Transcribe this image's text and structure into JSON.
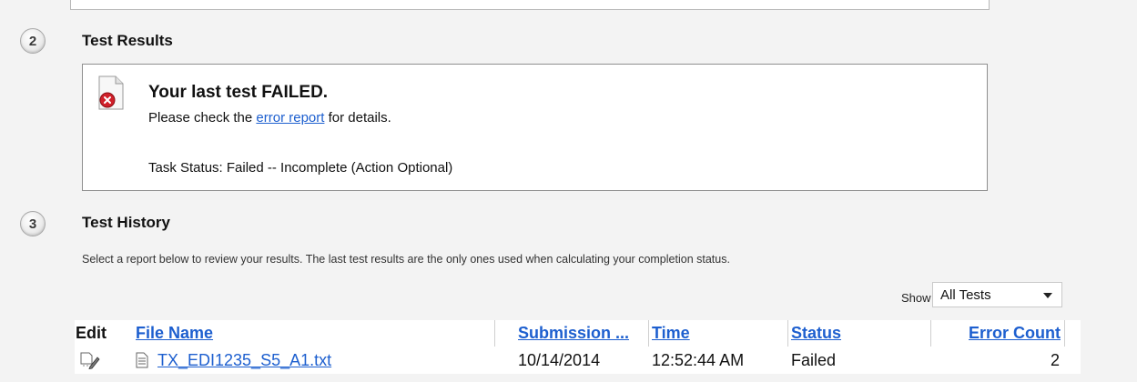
{
  "section2": {
    "number": "2",
    "title": "Test Results",
    "headline": "Your last test FAILED.",
    "message_before": "Please check the ",
    "message_link": "error report",
    "message_after": " for details.",
    "task_status": "Task Status: Failed -- Incomplete (Action Optional)"
  },
  "section3": {
    "number": "3",
    "title": "Test History",
    "description": "Select a report below to review your results. The last test results are the only ones used when calculating your completion status.",
    "show_label": "Show",
    "show_value": "All Tests"
  },
  "grid": {
    "columns": {
      "edit": "Edit",
      "file_name": "File Name",
      "submission": "Submission ...",
      "time": "Time",
      "status": "Status",
      "error_count": "Error Count"
    },
    "rows": [
      {
        "file_name": "TX_EDI1235_S5_A1.txt",
        "submission": "10/14/2014",
        "time": "12:52:44 AM",
        "status": "Failed",
        "error_count": "2"
      }
    ]
  },
  "icons": {
    "failed_document": "document-error-icon",
    "edit": "edit-pencil-icon",
    "text_file": "text-file-icon",
    "dropdown": "chevron-down-icon"
  },
  "colors": {
    "link": "#1d5fcf",
    "error": "#d0202a",
    "background": "#f3f3f3"
  }
}
